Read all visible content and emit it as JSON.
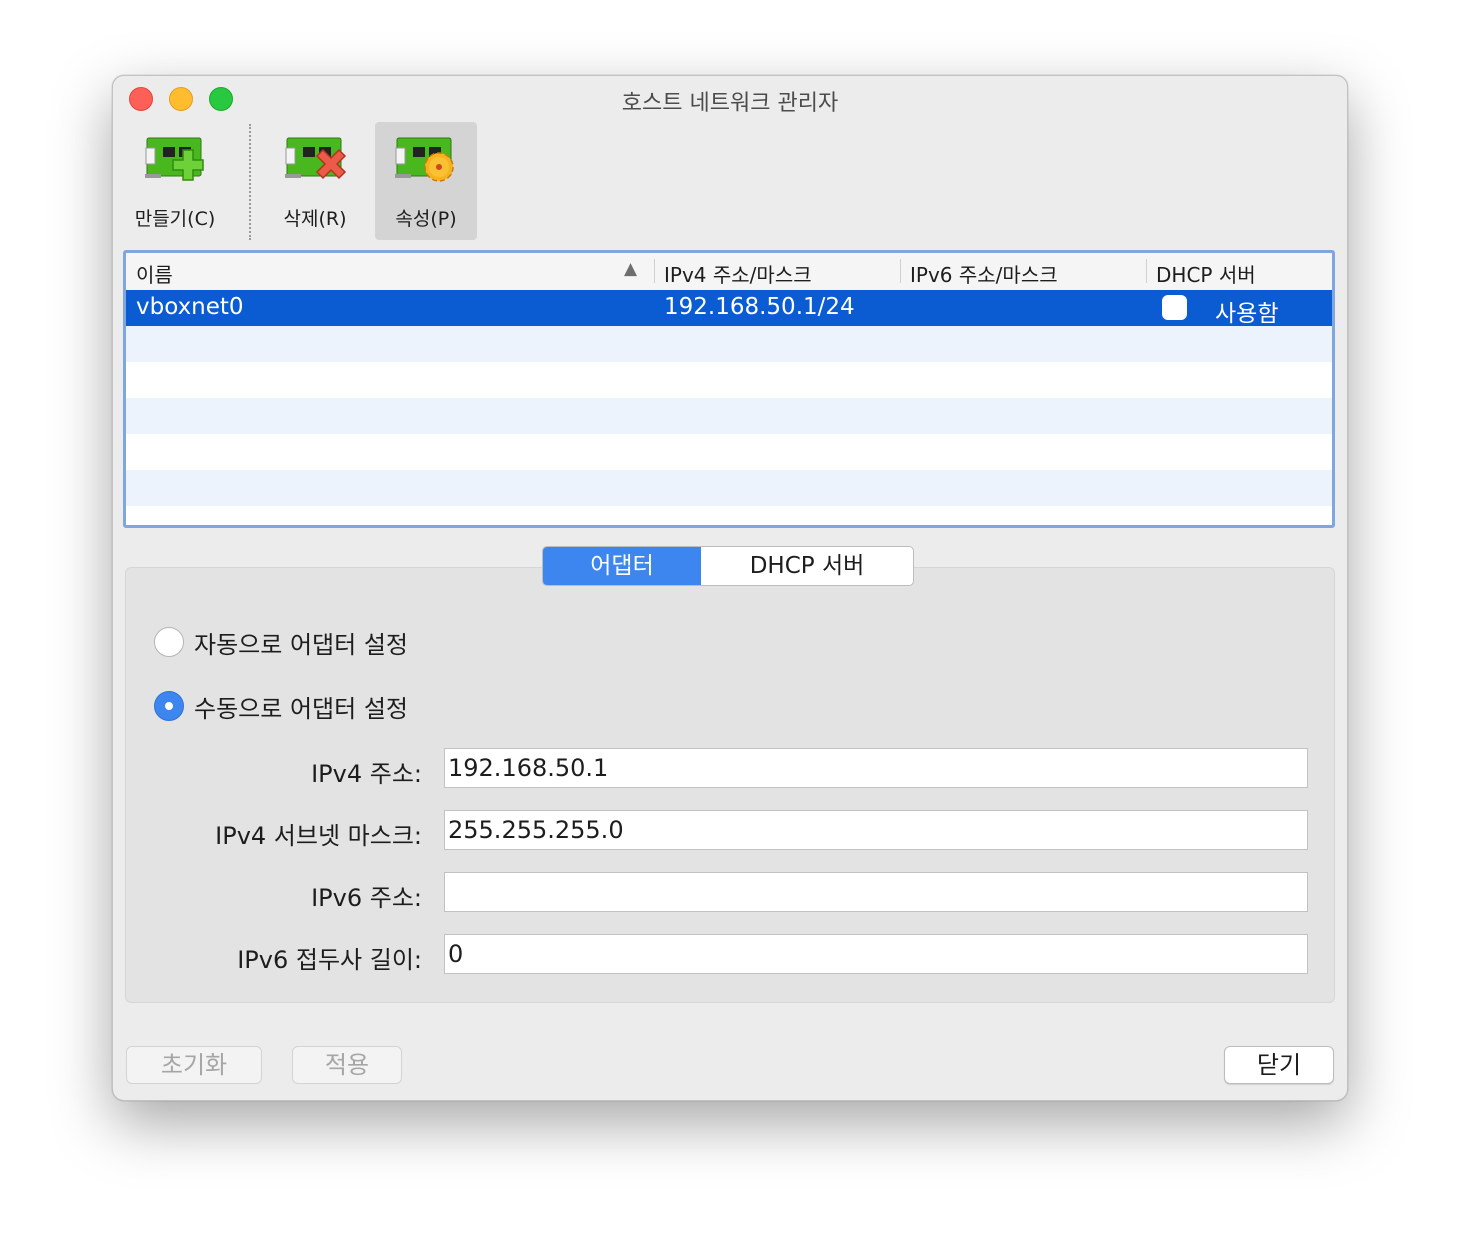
{
  "window": {
    "title": "호스트 네트워크 관리자"
  },
  "toolbar": {
    "create_label": "만들기(C)",
    "delete_label": "삭제(R)",
    "properties_label": "속성(P)"
  },
  "table": {
    "columns": [
      "이름",
      "IPv4 주소/마스크",
      "IPv6 주소/마스크",
      "DHCP 서버"
    ],
    "rows": [
      {
        "name": "vboxnet0",
        "ipv4": "192.168.50.1/24",
        "ipv6": "",
        "dhcp_checked": false,
        "dhcp_label": "사용함"
      }
    ]
  },
  "tabs": {
    "adapter": "어댑터",
    "dhcp": "DHCP 서버",
    "selected": "adapter"
  },
  "adapter": {
    "auto_label": "자동으로 어댑터 설정",
    "manual_label": "수동으로 어댑터 설정",
    "mode": "manual",
    "ipv4_address_label": "IPv4 주소:",
    "ipv4_address": "192.168.50.1",
    "ipv4_mask_label": "IPv4 서브넷 마스크:",
    "ipv4_mask": "255.255.255.0",
    "ipv6_address_label": "IPv6 주소:",
    "ipv6_address": "",
    "ipv6_prefix_label": "IPv6 접두사 길이:",
    "ipv6_prefix": "0"
  },
  "buttons": {
    "reset": "초기화",
    "apply": "적용",
    "close": "닫기"
  },
  "colors": {
    "selection": "#0b5bd3",
    "accent": "#3d86f0"
  }
}
